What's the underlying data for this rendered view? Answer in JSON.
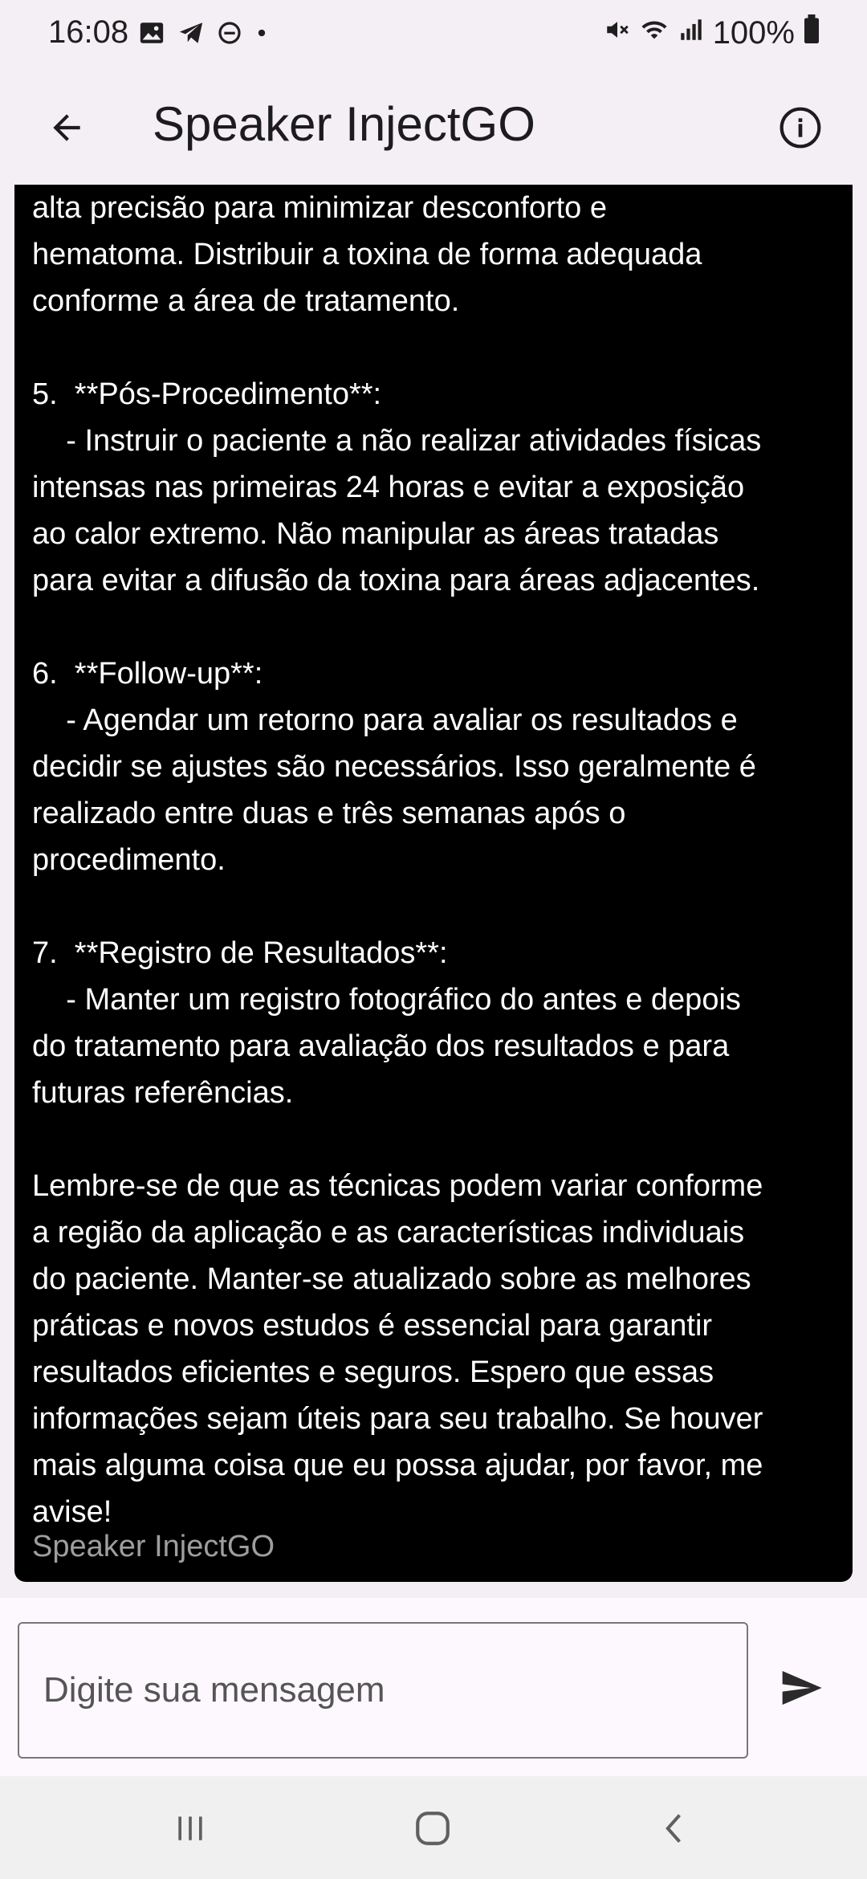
{
  "status_bar": {
    "time": "16:08",
    "battery": "100%",
    "left_icons": [
      "image-icon",
      "telegram-icon",
      "dnd-icon",
      "dot-icon"
    ],
    "right_icons": [
      "mute-icon",
      "wifi-icon",
      "signal-icon",
      "battery-icon"
    ]
  },
  "app_bar": {
    "title": "Speaker InjectGO",
    "back_icon": "arrow-back-icon",
    "info_icon": "info-icon"
  },
  "message": {
    "text": "alta precisão para minimizar desconforto e\nhematoma. Distribuir a toxina de forma adequada\nconforme a área de tratamento.\n\n5.  **Pós-Procedimento**:\n    - Instruir o paciente a não realizar atividades físicas\nintensas nas primeiras 24 horas e evitar a exposição\nao calor extremo. Não manipular as áreas tratadas\npara evitar a difusão da toxina para áreas adjacentes.\n\n6.  **Follow-up**:\n    - Agendar um retorno para avaliar os resultados e\ndecidir se ajustes são necessários. Isso geralmente é\nrealizado entre duas e três semanas após o\nprocedimento.\n\n7.  **Registro de Resultados**:\n    - Manter um registro fotográfico do antes e depois\ndo tratamento para avaliação dos resultados e para\nfuturas referências.\n\nLembre-se de que as técnicas podem variar conforme\na região da aplicação e as características individuais\ndo paciente. Manter-se atualizado sobre as melhores\npráticas e novos estudos é essencial para garantir\nresultados eficientes e seguros. Espero que essas\ninformações sejam úteis para seu trabalho. Se houver\nmais alguma coisa que eu possa ajudar, por favor, me\navise!",
    "sender": "Speaker InjectGO"
  },
  "input": {
    "placeholder": "Digite sua mensagem",
    "value": ""
  },
  "nav_bar": {
    "icons": [
      "recents-icon",
      "home-icon",
      "back-nav-icon"
    ]
  },
  "colors": {
    "background": "#f4eff4",
    "bubble": "#000000",
    "bubble_text": "#ffffff",
    "sender_text": "#9e9e9e"
  }
}
